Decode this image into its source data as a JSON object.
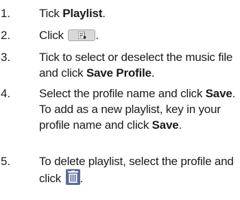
{
  "steps": [
    {
      "num": "1.",
      "pre": "Tick ",
      "bold": "Playlist",
      "post": "."
    },
    {
      "num": "2.",
      "pre": "Click ",
      "icon": "playlist-icon",
      "post": "."
    },
    {
      "num": "3.",
      "pre": "Tick to select or deselect the music file and click ",
      "bold": "Save Profile",
      "post": "."
    },
    {
      "num": "4.",
      "pre": "Select the profile name and click ",
      "bold": "Save",
      "mid": ". To add as a new playlist, key in your profile name and click ",
      "bold2": "Save",
      "post": "."
    },
    {
      "num": "5.",
      "pre": "To delete playlist, select the profile and click ",
      "icon": "trash-icon",
      "post": "."
    }
  ]
}
